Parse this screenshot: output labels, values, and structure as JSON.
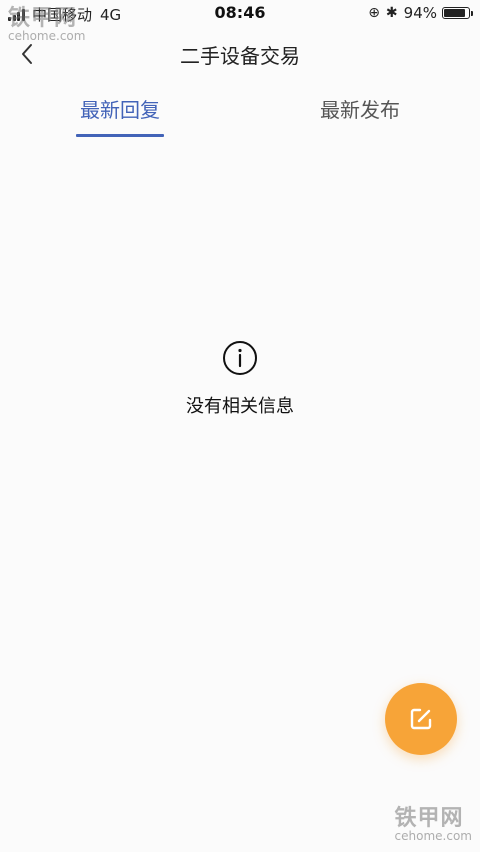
{
  "status_bar": {
    "carrier": "中国移动",
    "network": "4G",
    "time": "08:46",
    "battery_percent": "94%",
    "battery_level": 0.94
  },
  "watermark": {
    "brand": "铁甲网",
    "domain": "cehome.com"
  },
  "nav": {
    "title": "二手设备交易"
  },
  "tabs": [
    {
      "label": "最新回复",
      "active": true
    },
    {
      "label": "最新发布",
      "active": false
    }
  ],
  "empty_state": {
    "message": "没有相关信息"
  },
  "colors": {
    "accent": "#4263b8",
    "fab": "#f7a438"
  },
  "icons": {
    "back": "chevron-left-icon",
    "info": "info-icon",
    "compose": "edit-icon"
  }
}
